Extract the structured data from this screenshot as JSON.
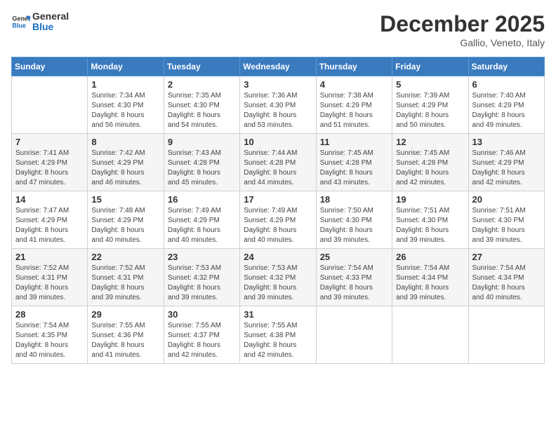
{
  "header": {
    "logo_line1": "General",
    "logo_line2": "Blue",
    "month": "December 2025",
    "location": "Gallio, Veneto, Italy"
  },
  "weekdays": [
    "Sunday",
    "Monday",
    "Tuesday",
    "Wednesday",
    "Thursday",
    "Friday",
    "Saturday"
  ],
  "weeks": [
    [
      {
        "day": "",
        "info": ""
      },
      {
        "day": "1",
        "info": "Sunrise: 7:34 AM\nSunset: 4:30 PM\nDaylight: 8 hours\nand 56 minutes."
      },
      {
        "day": "2",
        "info": "Sunrise: 7:35 AM\nSunset: 4:30 PM\nDaylight: 8 hours\nand 54 minutes."
      },
      {
        "day": "3",
        "info": "Sunrise: 7:36 AM\nSunset: 4:30 PM\nDaylight: 8 hours\nand 53 minutes."
      },
      {
        "day": "4",
        "info": "Sunrise: 7:38 AM\nSunset: 4:29 PM\nDaylight: 8 hours\nand 51 minutes."
      },
      {
        "day": "5",
        "info": "Sunrise: 7:39 AM\nSunset: 4:29 PM\nDaylight: 8 hours\nand 50 minutes."
      },
      {
        "day": "6",
        "info": "Sunrise: 7:40 AM\nSunset: 4:29 PM\nDaylight: 8 hours\nand 49 minutes."
      }
    ],
    [
      {
        "day": "7",
        "info": "Sunrise: 7:41 AM\nSunset: 4:29 PM\nDaylight: 8 hours\nand 47 minutes."
      },
      {
        "day": "8",
        "info": "Sunrise: 7:42 AM\nSunset: 4:29 PM\nDaylight: 8 hours\nand 46 minutes."
      },
      {
        "day": "9",
        "info": "Sunrise: 7:43 AM\nSunset: 4:28 PM\nDaylight: 8 hours\nand 45 minutes."
      },
      {
        "day": "10",
        "info": "Sunrise: 7:44 AM\nSunset: 4:28 PM\nDaylight: 8 hours\nand 44 minutes."
      },
      {
        "day": "11",
        "info": "Sunrise: 7:45 AM\nSunset: 4:28 PM\nDaylight: 8 hours\nand 43 minutes."
      },
      {
        "day": "12",
        "info": "Sunrise: 7:45 AM\nSunset: 4:28 PM\nDaylight: 8 hours\nand 42 minutes."
      },
      {
        "day": "13",
        "info": "Sunrise: 7:46 AM\nSunset: 4:29 PM\nDaylight: 8 hours\nand 42 minutes."
      }
    ],
    [
      {
        "day": "14",
        "info": "Sunrise: 7:47 AM\nSunset: 4:29 PM\nDaylight: 8 hours\nand 41 minutes."
      },
      {
        "day": "15",
        "info": "Sunrise: 7:48 AM\nSunset: 4:29 PM\nDaylight: 8 hours\nand 40 minutes."
      },
      {
        "day": "16",
        "info": "Sunrise: 7:49 AM\nSunset: 4:29 PM\nDaylight: 8 hours\nand 40 minutes."
      },
      {
        "day": "17",
        "info": "Sunrise: 7:49 AM\nSunset: 4:29 PM\nDaylight: 8 hours\nand 40 minutes."
      },
      {
        "day": "18",
        "info": "Sunrise: 7:50 AM\nSunset: 4:30 PM\nDaylight: 8 hours\nand 39 minutes."
      },
      {
        "day": "19",
        "info": "Sunrise: 7:51 AM\nSunset: 4:30 PM\nDaylight: 8 hours\nand 39 minutes."
      },
      {
        "day": "20",
        "info": "Sunrise: 7:51 AM\nSunset: 4:30 PM\nDaylight: 8 hours\nand 39 minutes."
      }
    ],
    [
      {
        "day": "21",
        "info": "Sunrise: 7:52 AM\nSunset: 4:31 PM\nDaylight: 8 hours\nand 39 minutes."
      },
      {
        "day": "22",
        "info": "Sunrise: 7:52 AM\nSunset: 4:31 PM\nDaylight: 8 hours\nand 39 minutes."
      },
      {
        "day": "23",
        "info": "Sunrise: 7:53 AM\nSunset: 4:32 PM\nDaylight: 8 hours\nand 39 minutes."
      },
      {
        "day": "24",
        "info": "Sunrise: 7:53 AM\nSunset: 4:32 PM\nDaylight: 8 hours\nand 39 minutes."
      },
      {
        "day": "25",
        "info": "Sunrise: 7:54 AM\nSunset: 4:33 PM\nDaylight: 8 hours\nand 39 minutes."
      },
      {
        "day": "26",
        "info": "Sunrise: 7:54 AM\nSunset: 4:34 PM\nDaylight: 8 hours\nand 39 minutes."
      },
      {
        "day": "27",
        "info": "Sunrise: 7:54 AM\nSunset: 4:34 PM\nDaylight: 8 hours\nand 40 minutes."
      }
    ],
    [
      {
        "day": "28",
        "info": "Sunrise: 7:54 AM\nSunset: 4:35 PM\nDaylight: 8 hours\nand 40 minutes."
      },
      {
        "day": "29",
        "info": "Sunrise: 7:55 AM\nSunset: 4:36 PM\nDaylight: 8 hours\nand 41 minutes."
      },
      {
        "day": "30",
        "info": "Sunrise: 7:55 AM\nSunset: 4:37 PM\nDaylight: 8 hours\nand 42 minutes."
      },
      {
        "day": "31",
        "info": "Sunrise: 7:55 AM\nSunset: 4:38 PM\nDaylight: 8 hours\nand 42 minutes."
      },
      {
        "day": "",
        "info": ""
      },
      {
        "day": "",
        "info": ""
      },
      {
        "day": "",
        "info": ""
      }
    ]
  ]
}
